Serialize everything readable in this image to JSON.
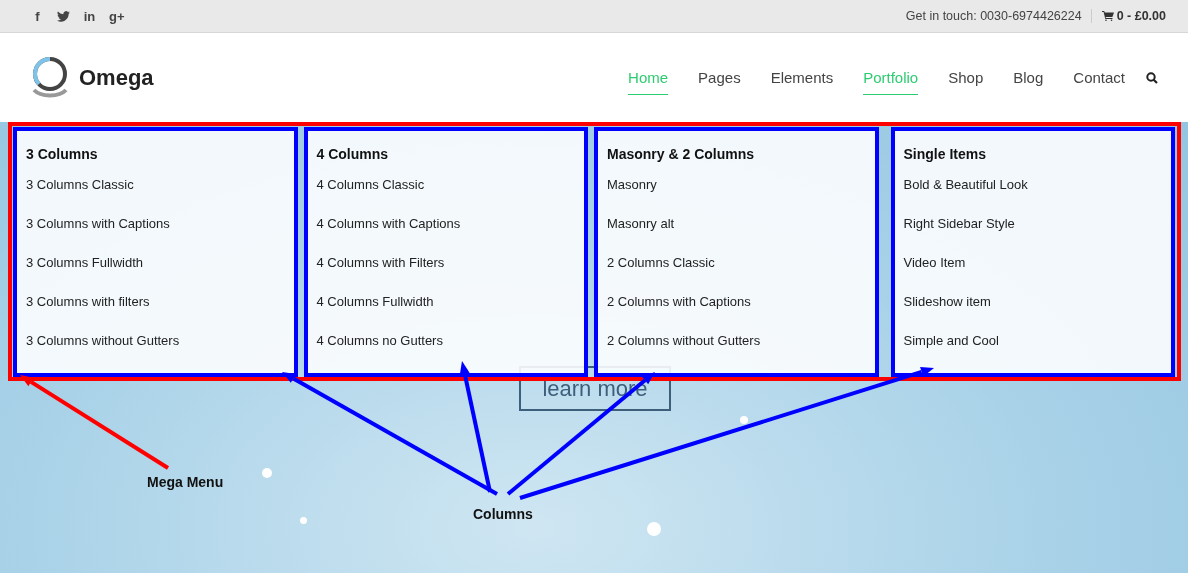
{
  "top_bar": {
    "social": [
      {
        "kind": "letter",
        "text": "f"
      },
      {
        "kind": "bird"
      },
      {
        "kind": "letter",
        "text": "in"
      },
      {
        "kind": "letter",
        "text": "g+"
      }
    ],
    "contact": "Get in touch: 0030-6974426224",
    "cart": "0 - £0.00"
  },
  "header": {
    "logo": "Omega",
    "nav": [
      {
        "label": "Home",
        "selected": true
      },
      {
        "label": "Pages",
        "selected": false
      },
      {
        "label": "Elements",
        "selected": false
      },
      {
        "label": "Portfolio",
        "selected": true
      },
      {
        "label": "Shop",
        "selected": false
      },
      {
        "label": "Blog",
        "selected": false
      },
      {
        "label": "Contact",
        "selected": false
      }
    ]
  },
  "hero": {
    "button": "learn more"
  },
  "mega_menu": {
    "columns": [
      {
        "heading": "3 Columns",
        "items": [
          "3 Columns Classic",
          "3 Columns with Captions",
          "3 Columns Fullwidth",
          "3 Columns with filters",
          "3 Columns without Gutters"
        ]
      },
      {
        "heading": "4 Columns",
        "items": [
          "4 Columns Classic",
          "4 Columns with Captions",
          "4 Columns with Filters",
          "4 Columns Fullwidth",
          "4 Columns no Gutters"
        ]
      },
      {
        "heading": "Masonry & 2 Columns",
        "items": [
          "Masonry",
          "Masonry alt",
          "2 Columns Classic",
          "2 Columns with Captions",
          "2 Columns without Gutters"
        ]
      },
      {
        "heading": "Single Items",
        "items": [
          "Bold & Beautiful Look",
          "Right Sidebar Style",
          "Video Item",
          "Slideshow item",
          "Simple and Cool"
        ]
      }
    ]
  },
  "annotations": [
    {
      "label": "Mega Menu",
      "color": "#ff0000"
    },
    {
      "label": "Columns",
      "color": "#0000ff"
    }
  ]
}
